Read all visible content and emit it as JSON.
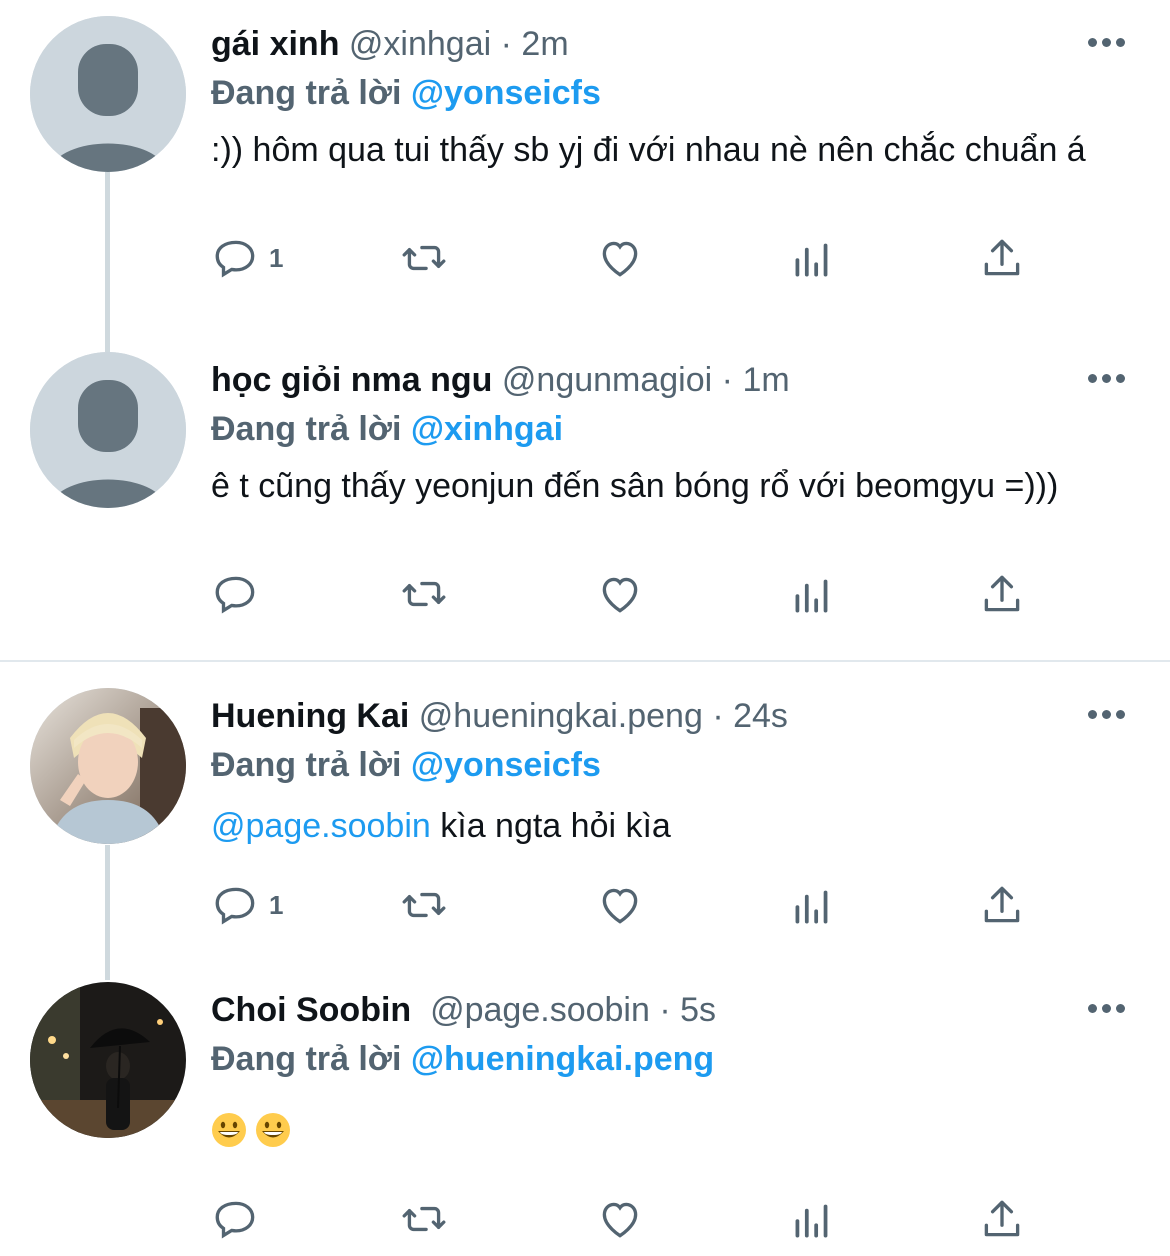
{
  "tweets": [
    {
      "name": "gái xinh",
      "handle": "@xinhgai",
      "sep": "·",
      "time": "2m",
      "replying_prefix": "Đang trả lời",
      "replying_to": "@yonseicfs",
      "text": ":)) hôm qua tui thấy sb yj đi với nhau nè nên chắc chuẩn á",
      "reply_count": "1",
      "avatar": "default-avatar-icon"
    },
    {
      "name": "học giỏi nma ngu",
      "handle": "@ngunmagioi",
      "sep": "·",
      "time": "1m",
      "replying_prefix": "Đang trả lời",
      "replying_to": "@xinhgai",
      "text": "ê t cũng thấy yeonjun đến sân bóng rổ với beomgyu =)))",
      "reply_count": "",
      "avatar": "default-avatar-icon"
    },
    {
      "name": "Huening Kai",
      "handle": "@hueningkai.peng",
      "sep": "·",
      "time": "24s",
      "replying_prefix": "Đang trả lời",
      "replying_to": "@yonseicfs",
      "text_mention": "@page.soobin",
      "text": " kìa ngta hỏi kìa",
      "reply_count": "1",
      "avatar": "photo-avatar"
    },
    {
      "name": "Choi Soobin",
      "handle": "@page.soobin",
      "sep": "·",
      "time": "5s",
      "replying_prefix": "Đang trả lời",
      "replying_to": "@hueningkai.peng",
      "text": "",
      "emojis": [
        "grinning-face-emoji",
        "grinning-face-emoji"
      ],
      "reply_count": "",
      "avatar": "photo-avatar"
    }
  ],
  "colors": {
    "accent": "#1d9bf0",
    "secondary": "#536471",
    "thread_line": "#cfd9de"
  }
}
